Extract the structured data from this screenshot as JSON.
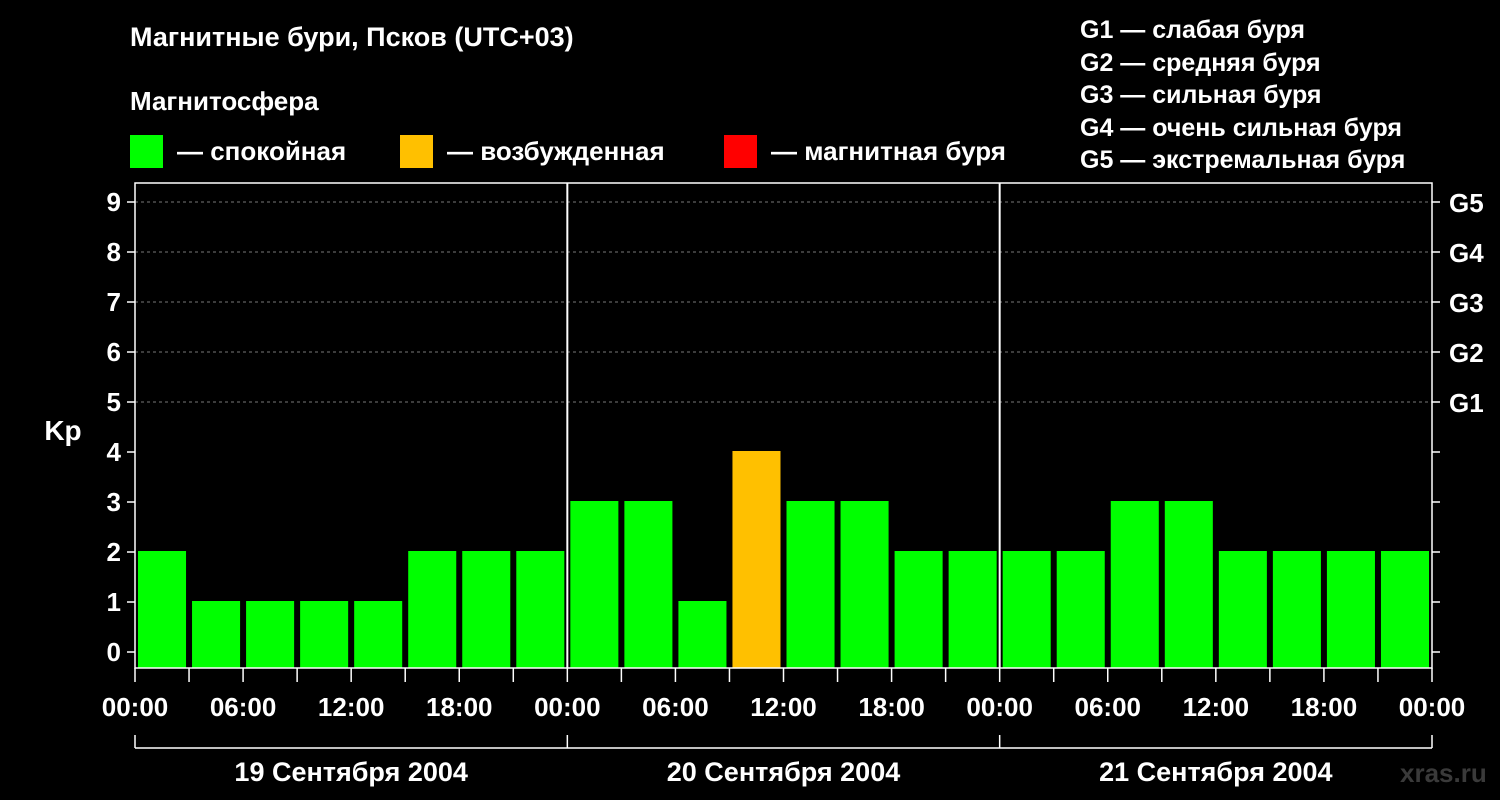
{
  "title": "Магнитные бури, Псков (UTC+03)",
  "subtitle": "Магнитосфера",
  "legend": [
    {
      "color": "#00ff00",
      "label": "— спокойная"
    },
    {
      "color": "#ffc000",
      "label": "— возбужденная"
    },
    {
      "color": "#ff0000",
      "label": "— магнитная буря"
    }
  ],
  "g_legend": [
    "G1 — слабая буря",
    "G2 — средняя буря",
    "G3 — сильная буря",
    "G4 — очень сильная буря",
    "G5 — экстремальная буря"
  ],
  "watermark": "xras.ru",
  "chart_data": {
    "type": "bar",
    "ylabel": "Kp",
    "ylim": [
      0,
      9
    ],
    "y_ticks": [
      0,
      1,
      2,
      3,
      4,
      5,
      6,
      7,
      8,
      9
    ],
    "right_ticks": [
      {
        "value": 5,
        "label": "G1"
      },
      {
        "value": 6,
        "label": "G2"
      },
      {
        "value": 7,
        "label": "G3"
      },
      {
        "value": 8,
        "label": "G4"
      },
      {
        "value": 9,
        "label": "G5"
      }
    ],
    "x_tick_labels": [
      "00:00",
      "06:00",
      "12:00",
      "18:00",
      "00:00",
      "06:00",
      "12:00",
      "18:00",
      "00:00",
      "06:00",
      "12:00",
      "18:00",
      "00:00"
    ],
    "days": [
      "19 Сентября 2004",
      "20 Сентября 2004",
      "21 Сентября 2004"
    ],
    "values": [
      2,
      1,
      1,
      1,
      1,
      2,
      2,
      2,
      3,
      3,
      1,
      4,
      3,
      3,
      2,
      2,
      2,
      2,
      3,
      3,
      2,
      2,
      2,
      2
    ],
    "colors": {
      "quiet": "#00ff00",
      "active": "#ffc000",
      "storm": "#ff0000"
    },
    "grid": "dashed at Kp 5-9"
  }
}
